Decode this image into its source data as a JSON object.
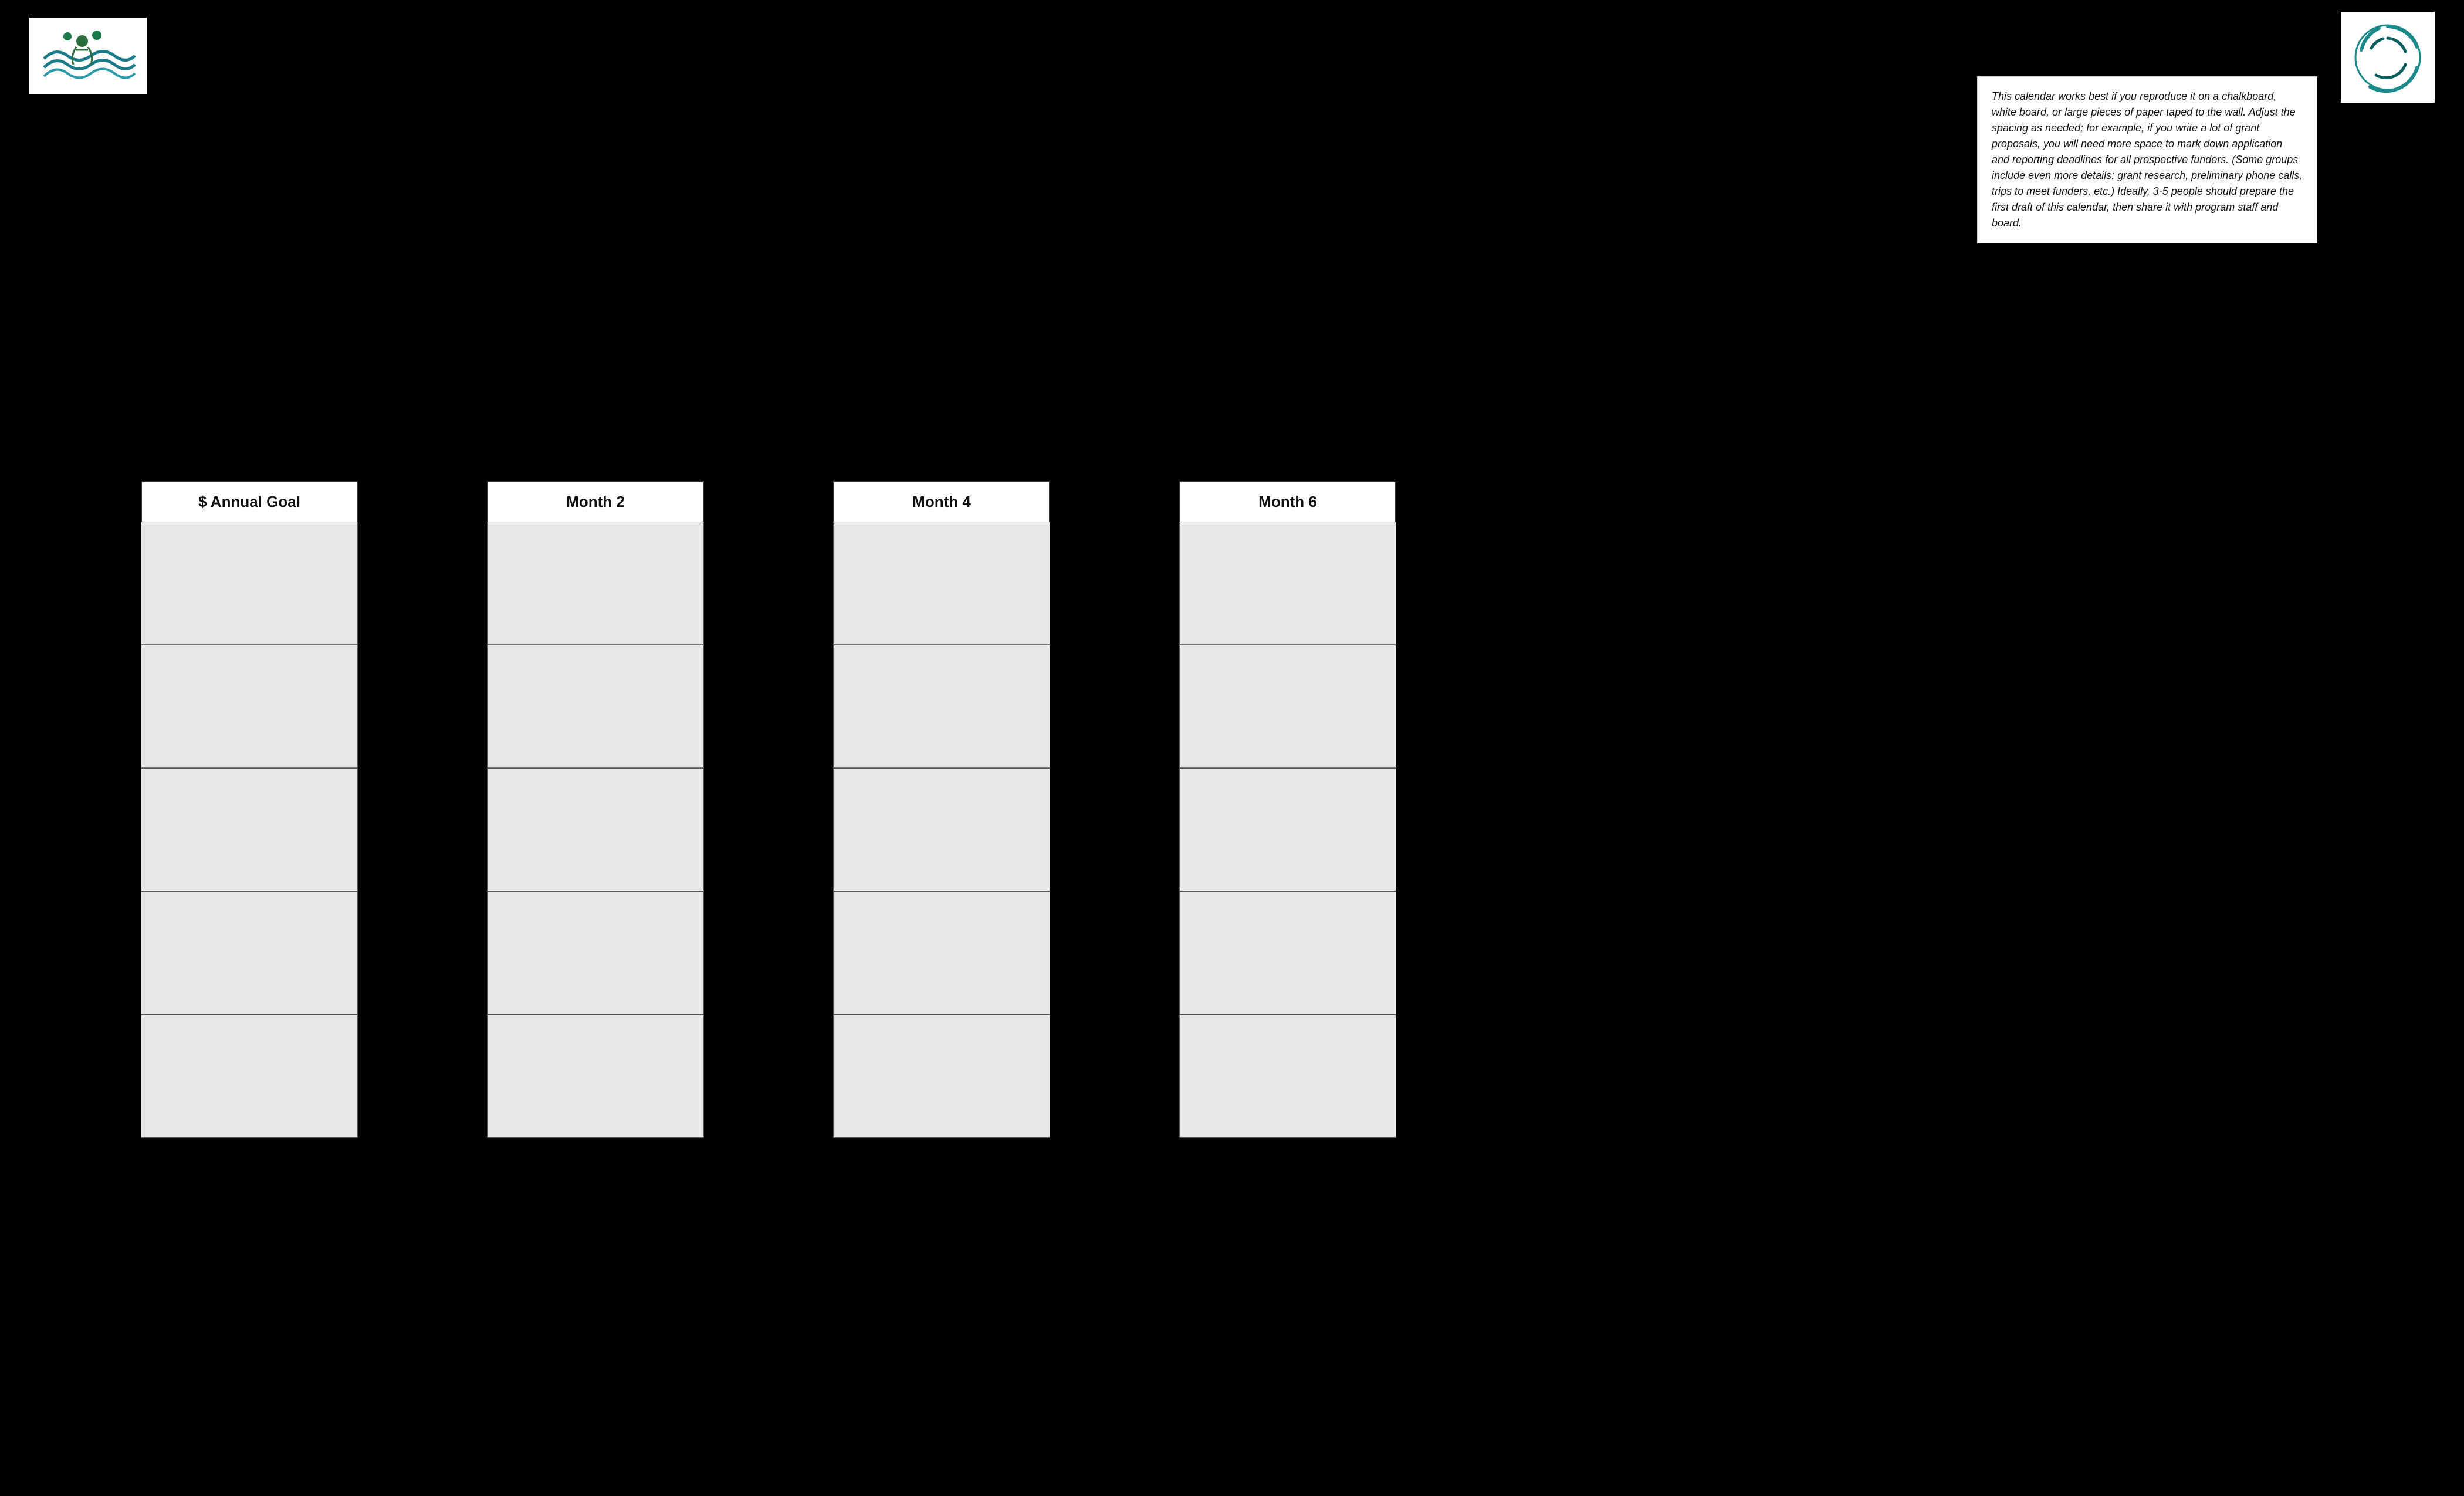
{
  "header": {
    "left_logo_alt": "Organization Logo Left",
    "right_logo_alt": "Organization Logo Right"
  },
  "info_box": {
    "text": "This calendar works best if you reproduce it on a chalkboard, white board, or large pieces of paper taped to the wall.  Adjust the spacing as needed; for example, if you write a lot of grant proposals, you will need more space to mark down application and reporting deadlines for all prospective funders. (Some groups include even more details: grant research, preliminary phone calls, trips to meet funders, etc.)  Ideally, 3-5 people should prepare the first draft of this calendar, then share it with program staff and board."
  },
  "columns": [
    {
      "id": "col1",
      "header": "$ Annual Goal",
      "rows": 5
    },
    {
      "id": "col2",
      "header": "Month 2",
      "rows": 5
    },
    {
      "id": "col3",
      "header": "Month 4",
      "rows": 5
    },
    {
      "id": "col4",
      "header": "Month 6",
      "rows": 5
    }
  ]
}
